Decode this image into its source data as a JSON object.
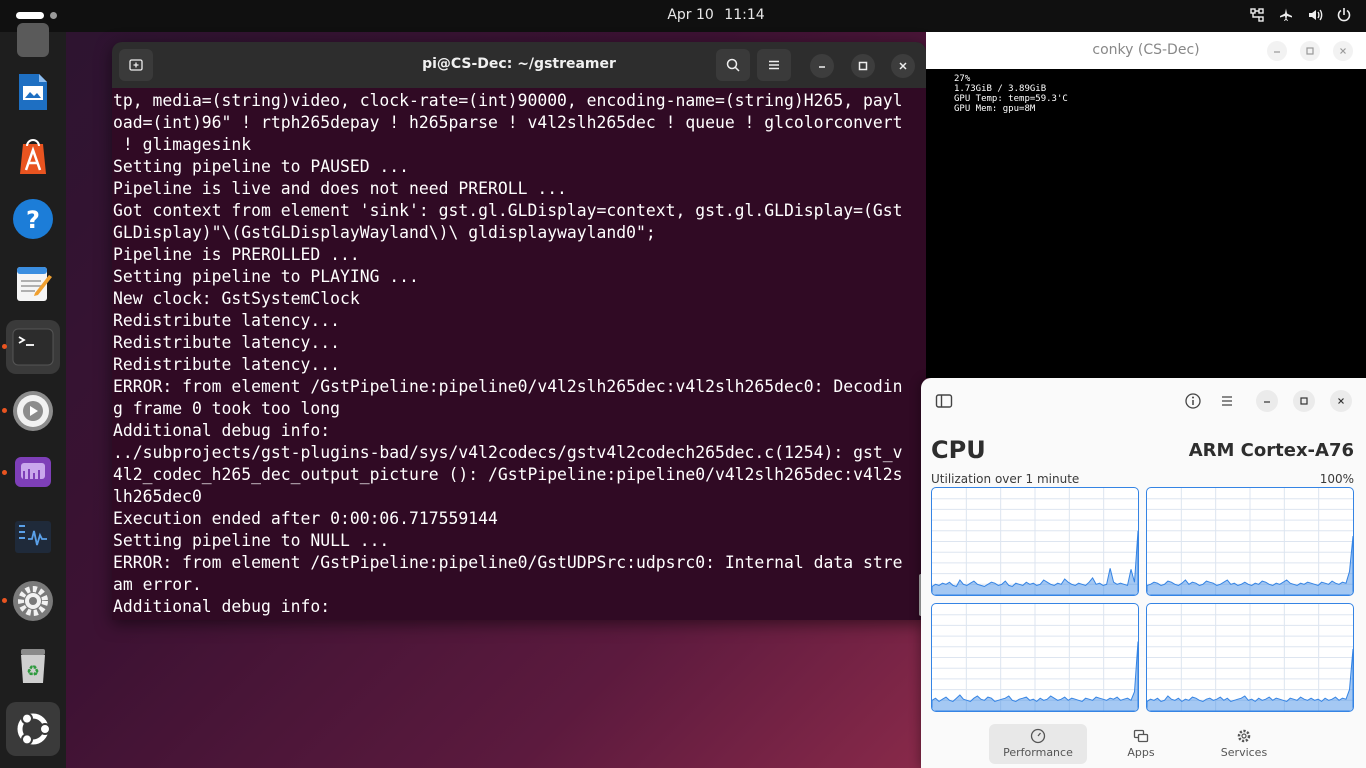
{
  "topbar": {
    "date": "Apr 10",
    "time": "11:14",
    "tray_icons": [
      "network-icon",
      "airplane-icon",
      "volume-icon",
      "power-icon"
    ]
  },
  "dock": {
    "items": [
      {
        "name": "libreoffice-impress",
        "running": false
      },
      {
        "name": "app-center",
        "running": false
      },
      {
        "name": "help",
        "running": false
      },
      {
        "name": "text-editor",
        "running": false
      },
      {
        "name": "terminal",
        "running": true,
        "active": true
      },
      {
        "name": "video-player",
        "running": true
      },
      {
        "name": "screenshot",
        "running": true
      },
      {
        "name": "system-monitor",
        "running": false
      },
      {
        "name": "settings",
        "running": true
      },
      {
        "name": "trash",
        "running": false
      },
      {
        "name": "show-apps",
        "running": false
      }
    ]
  },
  "terminal": {
    "title": "pi@CS-Dec: ~/gstreamer",
    "lines": [
      "tp, media=(string)video, clock-rate=(int)90000, encoding-name=(string)H265, payl",
      "oad=(int)96\" ! rtph265depay ! h265parse ! v4l2slh265dec ! queue ! glcolorconvert",
      " ! glimagesink",
      "Setting pipeline to PAUSED ...",
      "Pipeline is live and does not need PREROLL ...",
      "Got context from element 'sink': gst.gl.GLDisplay=context, gst.gl.GLDisplay=(Gst",
      "GLDisplay)\"\\(GstGLDisplayWayland\\)\\ gldisplaywayland0\";",
      "Pipeline is PREROLLED ...",
      "Setting pipeline to PLAYING ...",
      "New clock: GstSystemClock",
      "Redistribute latency...",
      "Redistribute latency...",
      "Redistribute latency...",
      "ERROR: from element /GstPipeline:pipeline0/v4l2slh265dec:v4l2slh265dec0: Decodin",
      "g frame 0 took too long",
      "Additional debug info:",
      "../subprojects/gst-plugins-bad/sys/v4l2codecs/gstv4l2codech265dec.c(1254): gst_v",
      "4l2_codec_h265_dec_output_picture (): /GstPipeline:pipeline0/v4l2slh265dec:v4l2s",
      "lh265dec0",
      "Execution ended after 0:00:06.717559144",
      "Setting pipeline to NULL ...",
      "ERROR: from element /GstPipeline:pipeline0/GstUDPSrc:udpsrc0: Internal data stre",
      "am error.",
      "Additional debug info:"
    ]
  },
  "conky": {
    "title": "conky (CS-Dec)",
    "lines": [
      "27%",
      "1.73GiB / 3.89GiB",
      "GPU Temp: temp=59.3'C",
      "GPU Mem: gpu=8M"
    ]
  },
  "sysmon": {
    "heading": "CPU",
    "model": "ARM Cortex-A76",
    "util_label": "Utilization over 1 minute",
    "util_max": "100%",
    "nav": {
      "performance": "Performance",
      "apps": "Apps",
      "services": "Services"
    },
    "cores": [
      [
        8,
        10,
        9,
        11,
        10,
        12,
        9,
        8,
        14,
        10,
        9,
        11,
        13,
        10,
        9,
        8,
        10,
        12,
        11,
        9,
        10,
        13,
        9,
        8,
        11,
        10,
        9,
        12,
        10,
        11,
        9,
        10,
        14,
        12,
        10,
        9,
        11,
        10,
        15,
        12,
        10,
        9,
        11,
        10,
        9,
        12,
        16,
        10,
        11,
        9,
        10,
        25,
        12,
        10,
        11,
        10,
        9,
        24,
        12,
        60
      ],
      [
        9,
        10,
        12,
        11,
        9,
        10,
        13,
        12,
        10,
        9,
        11,
        14,
        10,
        12,
        11,
        9,
        10,
        13,
        12,
        11,
        9,
        10,
        12,
        14,
        10,
        11,
        9,
        10,
        12,
        10,
        9,
        11,
        10,
        13,
        12,
        10,
        9,
        11,
        10,
        12,
        14,
        11,
        10,
        9,
        11,
        10,
        12,
        11,
        10,
        9,
        12,
        11,
        10,
        13,
        11,
        10,
        12,
        11,
        22,
        55
      ],
      [
        10,
        12,
        9,
        11,
        13,
        10,
        9,
        12,
        15,
        11,
        10,
        9,
        12,
        14,
        11,
        10,
        13,
        12,
        9,
        10,
        11,
        12,
        14,
        10,
        9,
        11,
        12,
        13,
        10,
        11,
        9,
        12,
        10,
        11,
        14,
        12,
        10,
        11,
        13,
        10,
        12,
        11,
        10,
        9,
        12,
        11,
        10,
        13,
        12,
        11,
        10,
        12,
        11,
        13,
        10,
        11,
        12,
        10,
        18,
        65
      ],
      [
        9,
        11,
        10,
        12,
        9,
        10,
        14,
        11,
        10,
        12,
        9,
        11,
        10,
        13,
        12,
        10,
        9,
        11,
        12,
        10,
        11,
        13,
        10,
        12,
        9,
        10,
        11,
        12,
        14,
        10,
        11,
        9,
        12,
        10,
        11,
        13,
        10,
        12,
        11,
        10,
        9,
        12,
        11,
        10,
        13,
        11,
        10,
        12,
        10,
        11,
        9,
        12,
        10,
        11,
        13,
        10,
        12,
        11,
        20,
        58
      ]
    ]
  },
  "colors": {
    "terminal_bg": "#300a24",
    "accent_blue": "#3584e4",
    "ubuntu_orange": "#e95420"
  }
}
